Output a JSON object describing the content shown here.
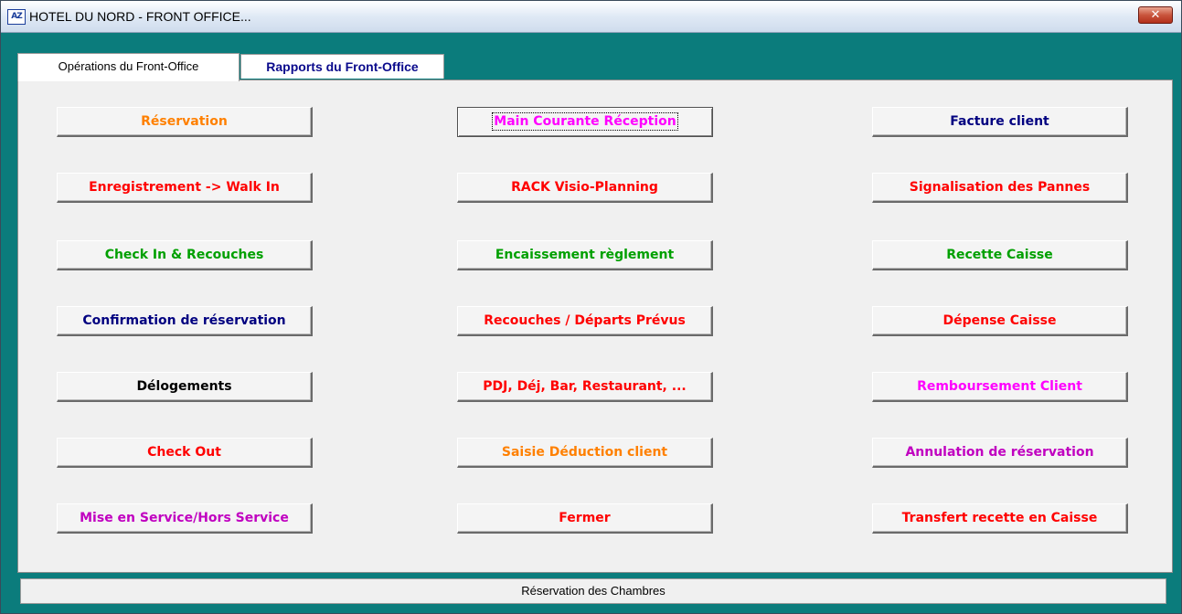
{
  "window": {
    "title": "HOTEL DU NORD - FRONT OFFICE...",
    "app_icon": "AZ",
    "close_symbol": "✕"
  },
  "tabs": [
    {
      "label": "Opérations du Front-Office",
      "active": true
    },
    {
      "label": "Rapports du Front-Office",
      "active": false
    }
  ],
  "buttons": {
    "reservation": "Réservation",
    "walk_in": "Enregistrement -> Walk In",
    "check_in": "Check In & Recouches",
    "confirmation": "Confirmation de réservation",
    "delogements": "Délogements",
    "check_out": "Check Out",
    "mise_en_service": "Mise en Service/Hors Service",
    "main_courante": "Main Courante Réception",
    "rack": "RACK Visio-Planning",
    "encaissement": "Encaissement règlement",
    "recouches_departs": "Recouches / Départs Prévus",
    "pdj": "PDJ, Déj, Bar, Restaurant, ...",
    "saisie_deduction": "Saisie Déduction client",
    "fermer": "Fermer",
    "facture": "Facture client",
    "pannes": "Signalisation des Pannes",
    "recette_caisse": "Recette Caisse",
    "depense_caisse": "Dépense Caisse",
    "remboursement": "Remboursement Client",
    "annulation": "Annulation de réservation",
    "transfert": "Transfert recette en Caisse"
  },
  "colors": {
    "frame": "#0b7c7c",
    "panel": "#f0f0f0",
    "orange": "#ff8000",
    "red": "#ff0000",
    "green": "#00a000",
    "navy": "#000080",
    "magenta": "#ff00ff",
    "purple": "#c000c0"
  },
  "status_bar": {
    "text": "Réservation des Chambres"
  }
}
